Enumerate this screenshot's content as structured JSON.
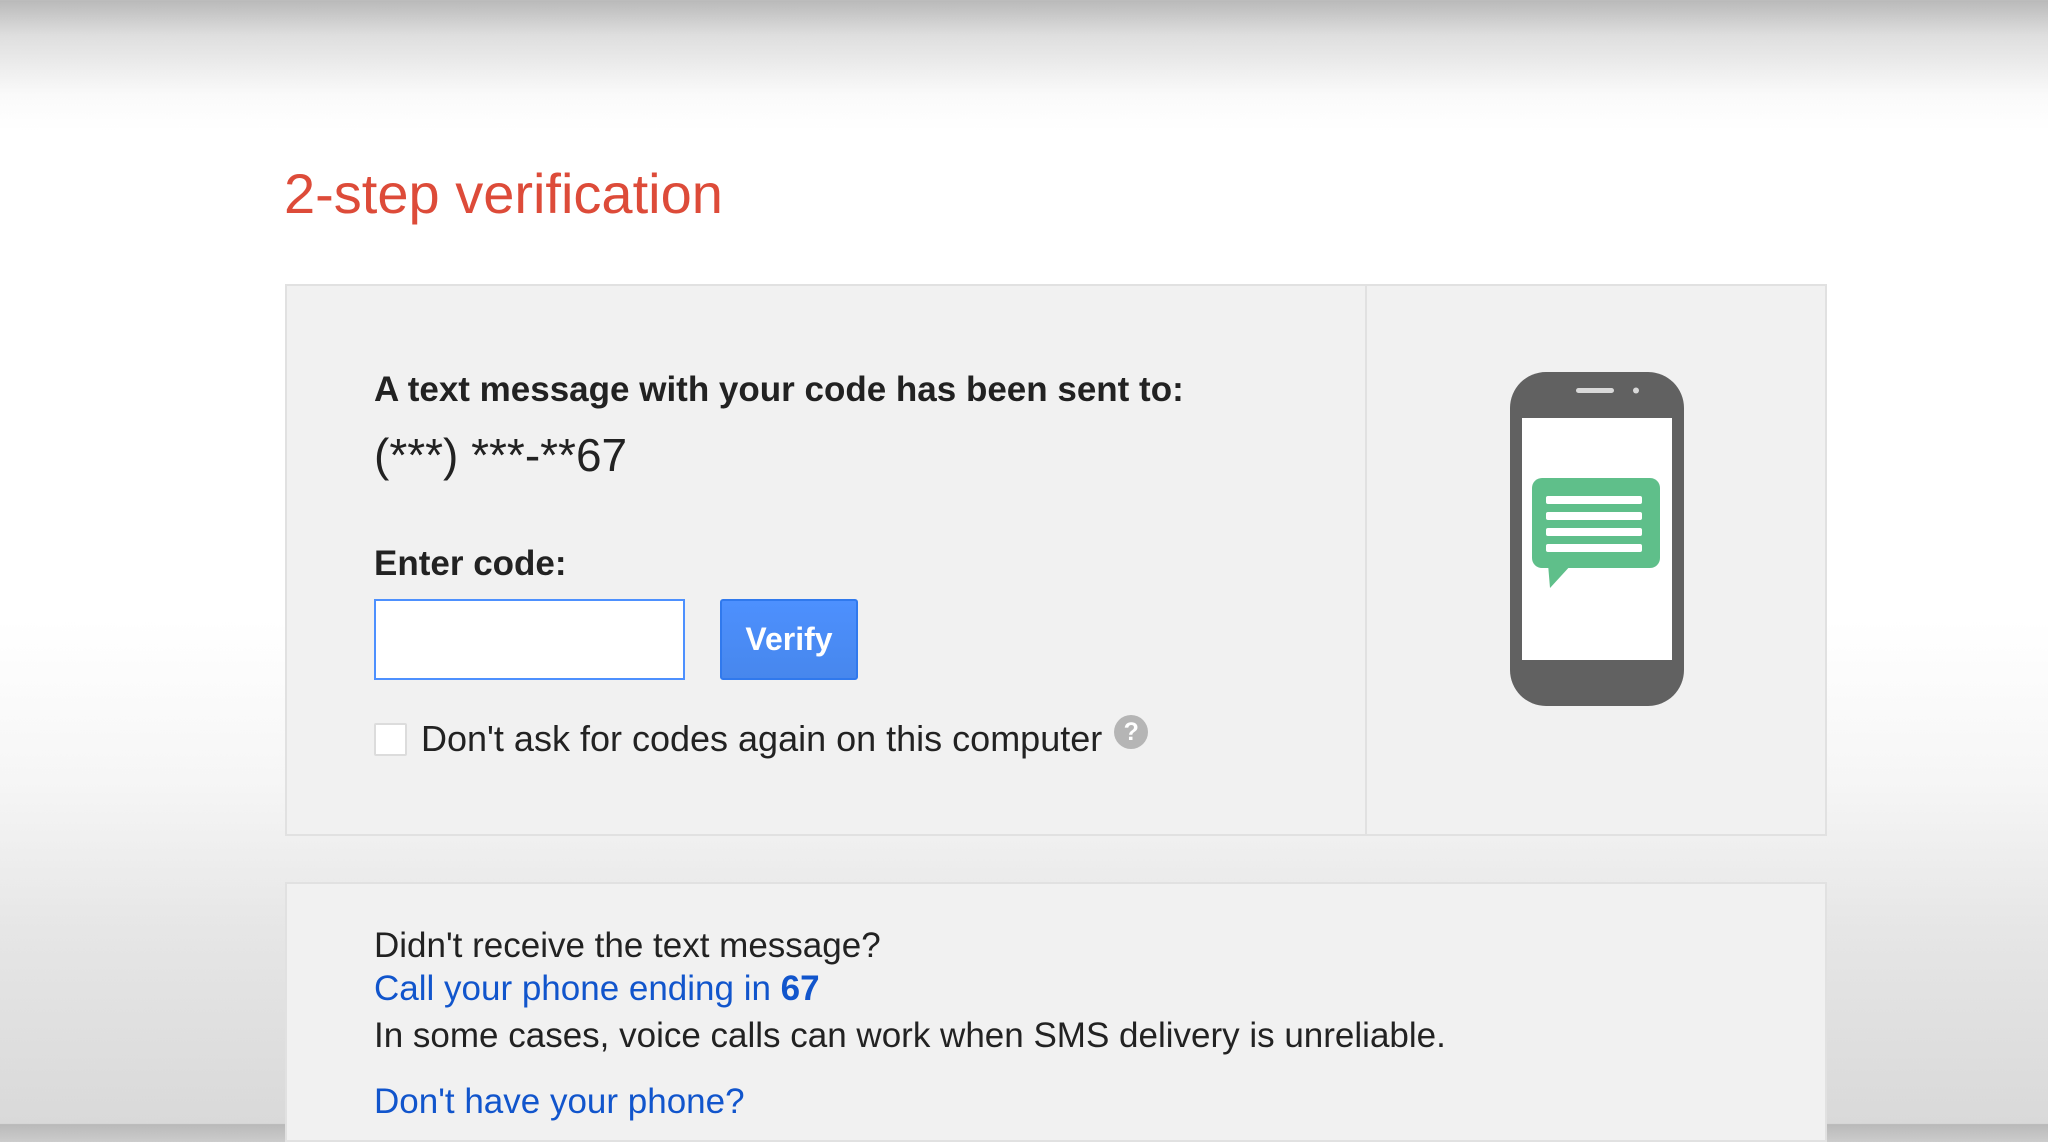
{
  "page": {
    "title": "2-step verification",
    "title_color": "#dd4b39"
  },
  "verification": {
    "sent_heading": "A text message with your code has been sent to:",
    "phone_masked": "(***) ***-**67",
    "code_label": "Enter code:",
    "code_value": "",
    "verify_label": "Verify",
    "remember_label": "Don't ask for codes again on this computer",
    "remember_checked": false,
    "help_icon": "question-mark-icon",
    "help_glyph": "?"
  },
  "illustration": {
    "icon": "phone-message-icon",
    "phone_color": "#616161",
    "bubble_color": "#5fbf8a"
  },
  "help": {
    "question": "Didn't receive the text message?",
    "call_link_prefix": "Call your phone ending in ",
    "call_link_digits": "67",
    "call_note": "In some cases, voice calls can work when SMS delivery is unreliable.",
    "no_phone_link": "Don't have your phone?",
    "link_color": "#1155cc"
  }
}
